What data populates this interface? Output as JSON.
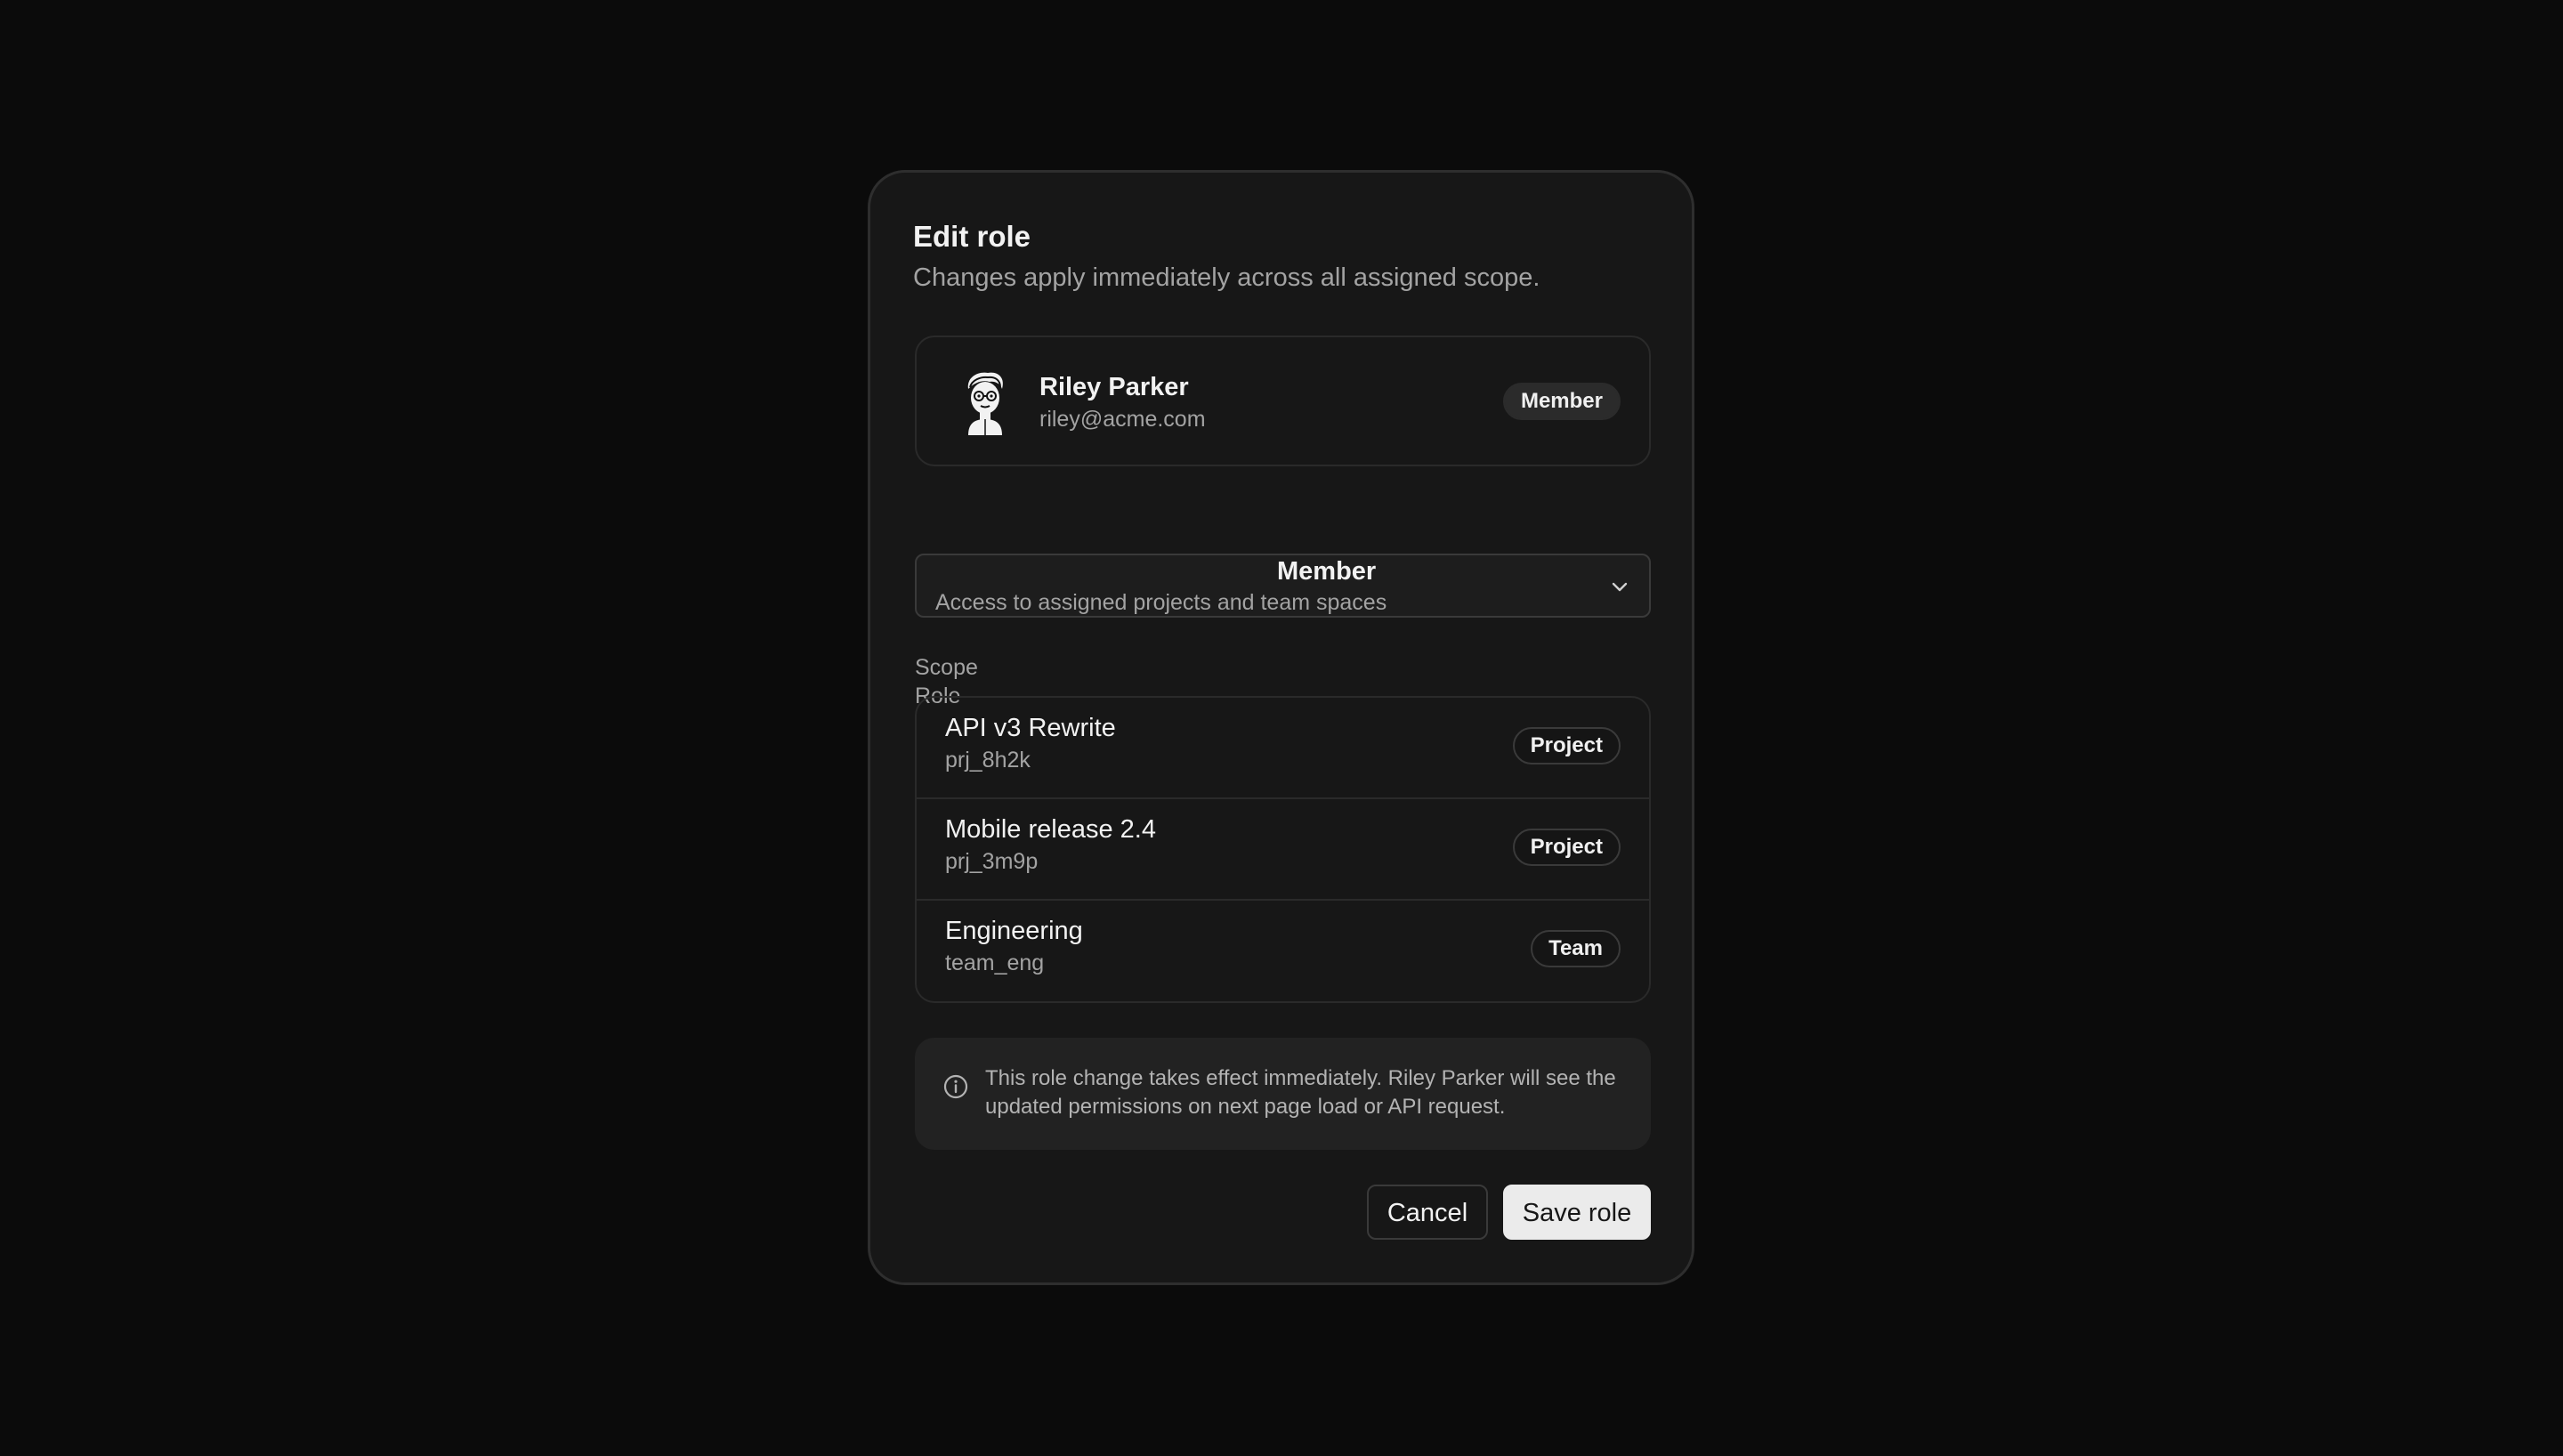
{
  "dialog": {
    "title": "Edit role",
    "subtitle": "Changes apply immediately across all assigned scope."
  },
  "user": {
    "name": "Riley Parker",
    "email": "riley@acme.com",
    "current_role_badge": "Member"
  },
  "role": {
    "label": "Role",
    "selected_name": "Member",
    "selected_description": "Access to assigned projects and team spaces"
  },
  "scope": {
    "label": "Scope",
    "items": [
      {
        "name": "API v3 Rewrite",
        "id": "prj_8h2k",
        "type": "Project"
      },
      {
        "name": "Mobile release 2.4",
        "id": "prj_3m9p",
        "type": "Project"
      },
      {
        "name": "Engineering",
        "id": "team_eng",
        "type": "Team"
      }
    ]
  },
  "notice": {
    "text": "This role change takes effect immediately. Riley Parker will see the updated permissions on next page load or API request."
  },
  "actions": {
    "cancel_label": "Cancel",
    "save_label": "Save role"
  },
  "icons": {
    "avatar": "user-avatar-illustration",
    "select": "chevron-down-icon",
    "notice": "info-icon"
  },
  "colors": {
    "background": "#0b0b0b",
    "dialog": "#171717",
    "primary_button": "#ebebeb"
  }
}
